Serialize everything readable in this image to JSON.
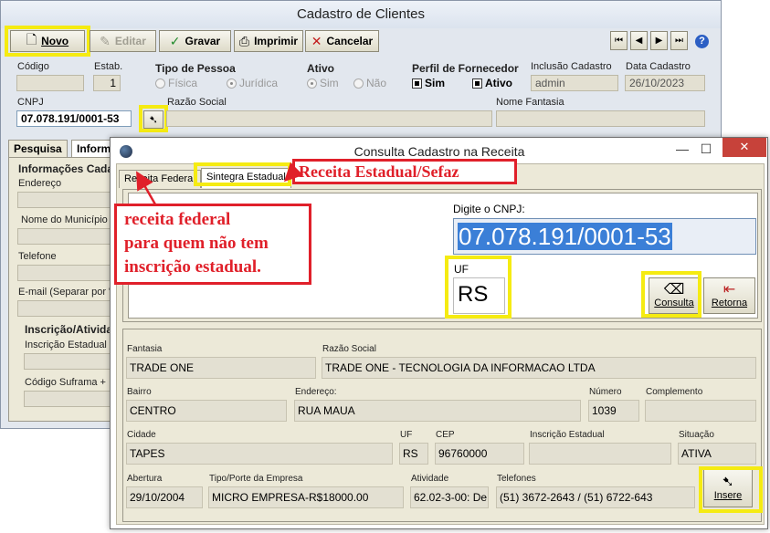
{
  "main": {
    "title": "Cadastro de Clientes",
    "toolbar": {
      "novo": "Novo",
      "editar": "Editar",
      "gravar": "Gravar",
      "imprimir": "Imprimir",
      "cancelar": "Cancelar"
    },
    "labels": {
      "codigo": "Código",
      "estab": "Estab.",
      "tipo_pessoa": "Tipo de Pessoa",
      "ativo": "Ativo",
      "perfil_fornecedor": "Perfil de Fornecedor",
      "inclusao_cadastro": "Inclusão Cadastro",
      "data_cadastro": "Data Cadastro",
      "cnpj": "CNPJ",
      "razao_social": "Razão Social",
      "nome_fantasia": "Nome Fantasia"
    },
    "values": {
      "estab": "1",
      "cnpj": "07.078.191/0001-53",
      "inclusao_cadastro": "admin",
      "data_cadastro": "26/10/2023"
    },
    "tipo_pessoa": {
      "fisica": "Física",
      "juridica": "Jurídica"
    },
    "ativo": {
      "sim": "Sim",
      "nao": "Não"
    },
    "perfil": {
      "sim": "Sim",
      "ativo": "Ativo"
    },
    "tabs": {
      "pesquisa": "Pesquisa",
      "informacoes": "Inform"
    },
    "left_panel": {
      "info_title": "Informações Cada",
      "endereco": "Endereço",
      "municipio": "Nome do Município",
      "telefone": "Telefone",
      "email": "E-mail (Separar por \";\")",
      "inscricao_title": "Inscrição/Ativida",
      "inscricao_estadual": "Inscrição Estadual",
      "suframa": "Código Suframa + IC"
    }
  },
  "dialog": {
    "title": "Consulta Cadastro na Receita",
    "tabs": {
      "receita_federal": "Receita Federal",
      "sintegra": "Sintegra Estadual"
    },
    "cnpj_label": "Digite o CNPJ:",
    "cnpj_value": "07.078.191/0001-53",
    "uf_label": "UF",
    "uf_value": "RS",
    "consulta_btn": "Consulta",
    "retorna_btn": "Retorna",
    "insere_btn": "Insere",
    "labels": {
      "fantasia": "Fantasia",
      "razao_social": "Razão Social",
      "bairro": "Bairro",
      "endereco": "Endereço:",
      "numero": "Número",
      "complemento": "Complemento",
      "cidade": "Cidade",
      "uf": "UF",
      "cep": "CEP",
      "inscricao_estadual": "Inscrição Estadual",
      "situacao": "Situação",
      "abertura": "Abertura",
      "tipo_porte": "Tipo/Porte da Empresa",
      "atividade": "Atividade",
      "telefones": "Telefones"
    },
    "values": {
      "fantasia": "TRADE ONE",
      "razao_social": "TRADE ONE - TECNOLOGIA DA INFORMACAO LTDA",
      "bairro": "CENTRO",
      "endereco": "RUA MAUA",
      "numero": "1039",
      "complemento": "",
      "cidade": "TAPES",
      "uf": "RS",
      "cep": "96760000",
      "inscricao_estadual": "",
      "situacao": "ATIVA",
      "abertura": "29/10/2004",
      "tipo_porte": "MICRO EMPRESA-R$18000.00",
      "atividade": "62.02-3-00: De",
      "telefones": "(51) 3672-2643 / (51) 6722-643"
    }
  },
  "annotations": {
    "sefaz": "Receita Estadual/Sefaz",
    "federal_line1": "receita federal",
    "federal_line2": "para quem não tem",
    "federal_line3": "inscrição estadual."
  },
  "colors": {
    "highlight_yellow": "#f5eb12",
    "annotation_red": "#e0202a",
    "selection_blue": "#3b7fd7"
  }
}
